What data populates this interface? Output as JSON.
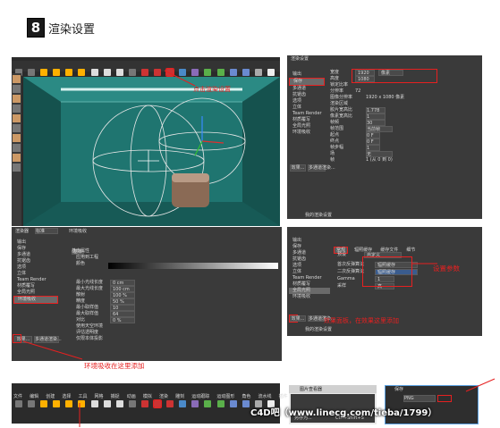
{
  "header": {
    "step_number": "8",
    "title": "渲染设置"
  },
  "annotations": {
    "click_render_settings": "点击渲染设置",
    "set_params": "设置参数",
    "add_effect_here": "效果面板，在效果这里添加",
    "ao_add_here": "环境吸收在这里添加"
  },
  "render_window": {
    "title": "渲染设置",
    "sidebar_items": [
      "输出",
      "保存",
      "多通道",
      "抗锯齿",
      "选项",
      "立体",
      "Team Render",
      "材质覆写",
      "全局光照",
      "环境吸收"
    ],
    "output_rows": [
      {
        "label": "宽度",
        "value": "1920"
      },
      {
        "label": "高度",
        "value": "1080"
      },
      {
        "label": "锁定比率",
        "value": ""
      },
      {
        "label": "分辨率",
        "value": "72"
      },
      {
        "label": "图像分辨率",
        "value": "1920 x 1080 像素"
      },
      {
        "label": "渲染区域",
        "value": ""
      },
      {
        "label": "胶片宽高比",
        "value": "1.778"
      },
      {
        "label": "像素宽高比",
        "value": "1"
      },
      {
        "label": "帧频",
        "value": "30"
      },
      {
        "label": "帧范围",
        "value": "当前帧"
      },
      {
        "label": "起点",
        "value": "0 F"
      },
      {
        "label": "终点",
        "value": "0 F"
      },
      {
        "label": "帧步幅",
        "value": "1"
      },
      {
        "label": "场",
        "value": "无"
      },
      {
        "label": "帧",
        "value": "1 (从 0 到 0)"
      }
    ],
    "unit": "像素",
    "renderer_label": "渲染器",
    "renderer_value": "标准",
    "effects_button": "效果...",
    "new_render_button": "多通道渲染...",
    "my_settings": "我的渲染设置"
  },
  "ao_panel": {
    "renderer_value": "标准",
    "tab_label": "环境吸收",
    "tabs": [
      "基本",
      "基本属性"
    ],
    "sidebar_items": [
      "输出",
      "保存",
      "多通道",
      "抗锯齿",
      "选项",
      "立体",
      "Team Render",
      "材质覆写",
      "全局光照",
      "环境吸收"
    ],
    "rows": [
      {
        "label": "应用到工程",
        "value": ""
      },
      {
        "label": "颜色",
        "value": ""
      },
      {
        "label": "最小光线长度",
        "value": "0 cm"
      },
      {
        "label": "最大光线长度",
        "value": "100 cm"
      },
      {
        "label": "散射",
        "value": "100 %"
      },
      {
        "label": "精度",
        "value": "50 %"
      },
      {
        "label": "最小取样值",
        "value": "10"
      },
      {
        "label": "最大取样值",
        "value": "64"
      },
      {
        "label": "对比",
        "value": "0 %"
      },
      {
        "label": "使用天空环境",
        "value": ""
      },
      {
        "label": "评估透明度",
        "value": ""
      },
      {
        "label": "仅限本体投影",
        "value": ""
      }
    ],
    "effects_button": "效果...",
    "new_render_button": "多通道渲染..."
  },
  "gi_panel": {
    "tabs": [
      "常规",
      "辐照缓存",
      "缓存文件",
      "细节"
    ],
    "preset_label": "预设",
    "preset_value": "自定义",
    "rows": [
      {
        "label": "首次反弹算法",
        "value": "辐照缓存"
      },
      {
        "label": "二次反弹算法",
        "value": "辐照缓存"
      },
      {
        "label": "Gamma",
        "value": "1"
      },
      {
        "label": "采样",
        "value": "高"
      }
    ]
  },
  "bottom_menu": [
    "文件",
    "编辑",
    "创建",
    "选择",
    "工具",
    "网格",
    "捕捉",
    "动画",
    "模拟",
    "渲染",
    "雕刻",
    "运动跟踪",
    "运动图形",
    "角色",
    "流水线",
    "插件",
    "脚本",
    "窗口",
    "帮助"
  ],
  "dialog_picture_viewer": {
    "title": "图片查看器",
    "item1": "另存为...",
    "item2": "Ctrl+Shift+S"
  },
  "dialog_save": {
    "title": "保存",
    "format": "PNG"
  },
  "watermark": "C4D吧（www.linecg.com/tieba/1799）",
  "colors": {
    "annotation_red": "#e62020",
    "viewport_teal": "#1d6f6a",
    "header_black": "#1a1a1a"
  }
}
